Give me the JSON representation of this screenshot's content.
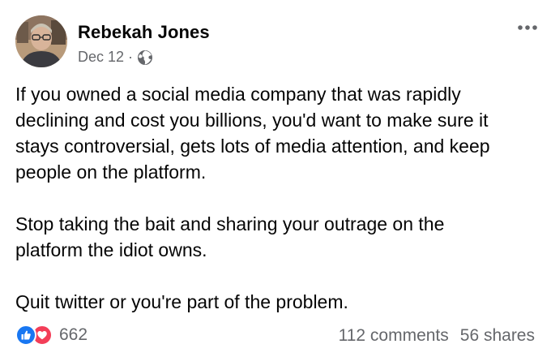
{
  "post": {
    "author_name": "Rebekah Jones",
    "date": "Dec 12",
    "separator": "·",
    "privacy_icon": "globe-icon",
    "more_icon": "more-options-icon",
    "paragraphs": [
      "If you owned a social media company that was rapidly\ndeclining and cost you billions, you'd want to make sure it\nstays controversial, gets lots of media attention, and keep\npeople on the platform.",
      "Stop taking the bait and sharing your outrage on the\nplatform the idiot owns.",
      "Quit twitter or you're part of the problem."
    ]
  },
  "footer": {
    "reaction_icons": [
      "like-icon",
      "love-icon"
    ],
    "reaction_count": "662",
    "comments": "112 comments",
    "shares": "56 shares"
  },
  "colors": {
    "text": "#050505",
    "secondary_text": "#65676b",
    "like_blue": "#1877f2",
    "love_red": "#f33e58"
  }
}
